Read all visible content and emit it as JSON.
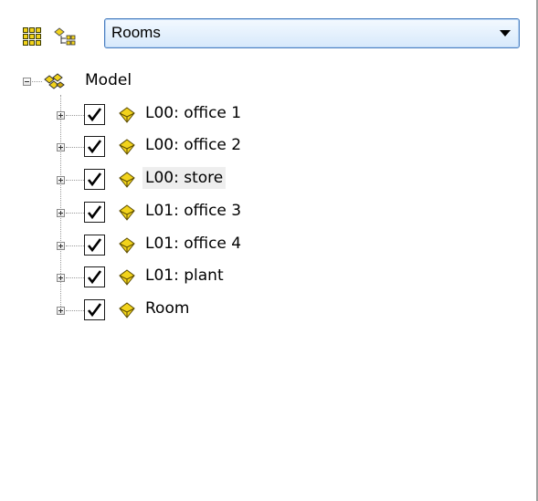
{
  "toolbar": {
    "grid_icon": "grid-icon",
    "hierarchy_icon": "hierarchy-icon",
    "selection_dropdown": {
      "value": "Rooms"
    }
  },
  "tree": {
    "root": {
      "label": "Model",
      "expanded": true,
      "icon": "model-group-icon"
    },
    "items": [
      {
        "label": "L00: office 1",
        "checked": true,
        "icon": "room-icon",
        "selected": false
      },
      {
        "label": "L00: office 2",
        "checked": true,
        "icon": "room-icon",
        "selected": false
      },
      {
        "label": "L00: store",
        "checked": true,
        "icon": "room-icon",
        "selected": true
      },
      {
        "label": "L01: office 3",
        "checked": true,
        "icon": "room-icon",
        "selected": false
      },
      {
        "label": "L01: office 4",
        "checked": true,
        "icon": "room-icon",
        "selected": false
      },
      {
        "label": "L01: plant",
        "checked": true,
        "icon": "room-icon",
        "selected": false
      },
      {
        "label": "Room",
        "checked": true,
        "icon": "room-icon",
        "selected": false
      }
    ]
  },
  "colors": {
    "dropdown_border": "#4b7fc0",
    "icon_yellow": "#f2d31b",
    "selected_bg": "#eeeeee"
  }
}
